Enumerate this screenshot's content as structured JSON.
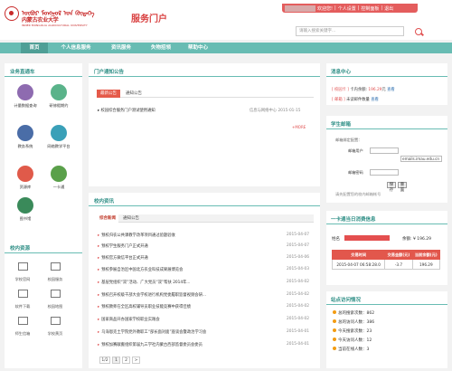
{
  "header": {
    "logo_mongol": "ᠥᠪᠦᠷ ᠮᠣᠩᠭᠣᠯ ᠤᠨ ᠬᠥᠳᠡᠭᠡ",
    "logo_cn": "内蒙古农业大学",
    "logo_en": "INNER MONGOLIA AGRICULTURAL UNIVERSITY",
    "portal_title": "服务门户",
    "topbar": {
      "welcome": "欢迎您!",
      "personal": "个人设置",
      "control": "控制面板",
      "logout": "退出"
    },
    "search_placeholder": "请输入搜索关键字..."
  },
  "nav": [
    "首页",
    "个人信息服务",
    "资讯服务",
    "失物招领",
    "帮助中心"
  ],
  "sidebar": {
    "business_title": "业务直通车",
    "business": [
      {
        "label": "计量数据查询",
        "icon": "data-query-icon",
        "color": "#8e6bb0"
      },
      {
        "label": "研修假期约",
        "icon": "leave-icon",
        "color": "#5ab38a"
      },
      {
        "label": "教务系统",
        "icon": "teaching-icon",
        "color": "#4a6da7"
      },
      {
        "label": "网络教学平台",
        "icon": "network-icon",
        "color": "#3aa0b8"
      },
      {
        "label": "资源库",
        "icon": "camera-icon",
        "color": "#e05a4a"
      },
      {
        "label": "一卡通",
        "icon": "card-icon",
        "color": "#5aa04a"
      },
      {
        "label": "图书馆",
        "icon": "library-icon",
        "color": "#3a8a5a"
      }
    ],
    "resources_title": "校内资源",
    "resources": [
      {
        "label": "学校官网",
        "icon": "home-icon"
      },
      {
        "label": "校园服务",
        "icon": "portal-icon"
      },
      {
        "label": "软件下载",
        "icon": "download-icon"
      },
      {
        "label": "校园地图",
        "icon": "map-icon"
      },
      {
        "label": "师生信箱",
        "icon": "mail-icon"
      },
      {
        "label": "学校黄页",
        "icon": "phonebook-icon"
      }
    ]
  },
  "notice": {
    "title": "门户通知公告",
    "tabs": [
      "最新公告",
      "通知公告"
    ],
    "items": [
      {
        "text": "校园综合服务门户测试使用通知",
        "source": "信息与网络中心",
        "date": "2015-01-15"
      }
    ],
    "more": "+MORE"
  },
  "news": {
    "title": "校内资讯",
    "tabs": [
      "综合新闻",
      "通知公告"
    ],
    "items": [
      {
        "text": "预校归农公共课教学改革项目通过验题验收",
        "date": "2015-04-07"
      },
      {
        "text": "预校学生服务门户正式开通",
        "date": "2015-04-07"
      },
      {
        "text": "预校官方微信平台正式开通",
        "date": "2015-04-06"
      },
      {
        "text": "预校参展自治区中国北方农业科技成果展博览会",
        "date": "2015-04-03"
      },
      {
        "text": "基层党组织“双”活动、广大党员“双”帮扶 2014年...",
        "date": "2015-04-02"
      },
      {
        "text": "预校召开校级干部大会学校进行机构党委履职监督视频会研...",
        "date": "2015-04-02"
      },
      {
        "text": "预校教师在全区高校辅导员职业技能竞赛中获得佳绩",
        "date": "2015-04-02"
      },
      {
        "text": "国家商品开办国家学校职业实践会",
        "date": "2015-04-02"
      },
      {
        "text": "乌海恩克土学院党外教职工“部长面对面”座谈会暨政治学习会",
        "date": "2015-04-01"
      },
      {
        "text": "预校加赛献搬组织第届九三学社内蒙古西部监督委员会委员",
        "date": "2015-04-01"
      }
    ],
    "pages": [
      "1/2",
      "1",
      "2",
      ">"
    ]
  },
  "message_center": {
    "title": "消息中心",
    "row1_tag": "[ 校园卡 ]",
    "row1_text": "卡内余额:",
    "row1_value": "196.29",
    "row1_suffix": "元",
    "row1_link": "查看",
    "row2_tag": "[ 邮箱 ]",
    "row2_text": "未读邮件数量",
    "row2_link": "查看"
  },
  "mail": {
    "title": "学生邮箱",
    "status_label": "邮箱绑定配置：",
    "user_label": "邮箱用户",
    "domain": "emails.imau.edu.cn",
    "pass_label": "邮箱密码",
    "save": "保存",
    "reset": "重置",
    "hint": "请先配置您的校内邮箱帐号"
  },
  "card": {
    "title": "一卡通当日消费信息",
    "name_label": "姓名",
    "balance_label": "余额: ¥ 196.29",
    "headers": [
      "交易时间",
      "交易金额(元)",
      "当前余额(元)"
    ],
    "rows": [
      [
        "2015-04-07 06:58:28.0",
        "-3.7",
        "196.29"
      ]
    ]
  },
  "site_stats": {
    "title": "站点访问情况",
    "items": [
      {
        "label": "总的搜索次数：",
        "value": "862"
      },
      {
        "label": "总的访问人数：",
        "value": "386"
      },
      {
        "label": "今天搜索次数：",
        "value": "23"
      },
      {
        "label": "今天访问人数：",
        "value": "12"
      },
      {
        "label": "当前在线人数：",
        "value": "3"
      }
    ]
  }
}
